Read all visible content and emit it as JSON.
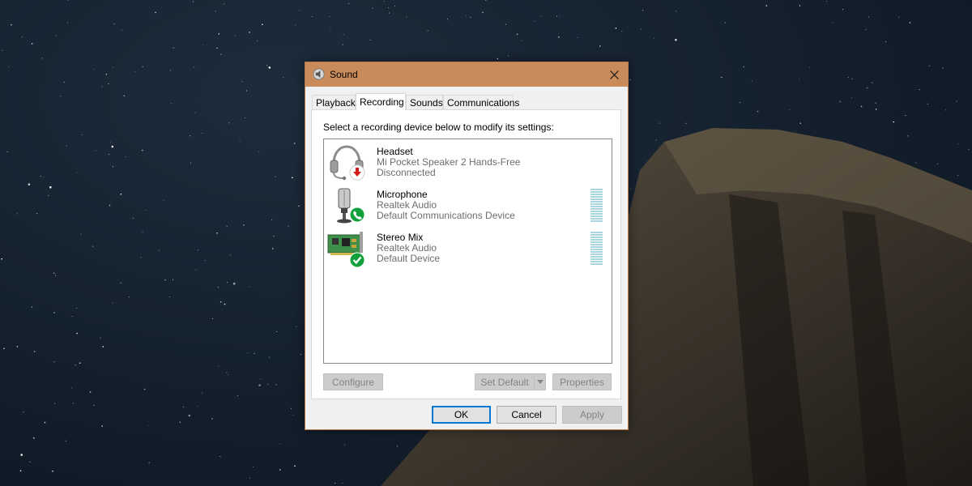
{
  "window": {
    "title": "Sound",
    "icon": "speaker-icon",
    "close_icon": "close-icon"
  },
  "tabs": [
    {
      "label": "Playback",
      "active": false
    },
    {
      "label": "Recording",
      "active": true
    },
    {
      "label": "Sounds",
      "active": false
    },
    {
      "label": "Communications",
      "active": false
    }
  ],
  "instruction": "Select a recording device below to modify its settings:",
  "devices": [
    {
      "name": "Headset",
      "detail": "Mi Pocket Speaker 2 Hands-Free",
      "status": "Disconnected",
      "icon": "headset-icon",
      "badge": "disconnected-arrow-icon",
      "badge_color": "#d41a1a",
      "meter": false
    },
    {
      "name": "Microphone",
      "detail": "Realtek Audio",
      "status": "Default Communications Device",
      "icon": "microphone-icon",
      "badge": "phone-icon",
      "badge_color": "#11a03c",
      "meter": true
    },
    {
      "name": "Stereo Mix",
      "detail": "Realtek Audio",
      "status": "Default Device",
      "icon": "sound-card-icon",
      "badge": "checkmark-icon",
      "badge_color": "#11a03c",
      "meter": true
    }
  ],
  "buttons": {
    "configure": "Configure",
    "set_default": "Set Default",
    "properties": "Properties",
    "ok": "OK",
    "cancel": "Cancel",
    "apply": "Apply"
  },
  "colors": {
    "titlebar": "#c98b59",
    "accent": "#0078d7"
  }
}
